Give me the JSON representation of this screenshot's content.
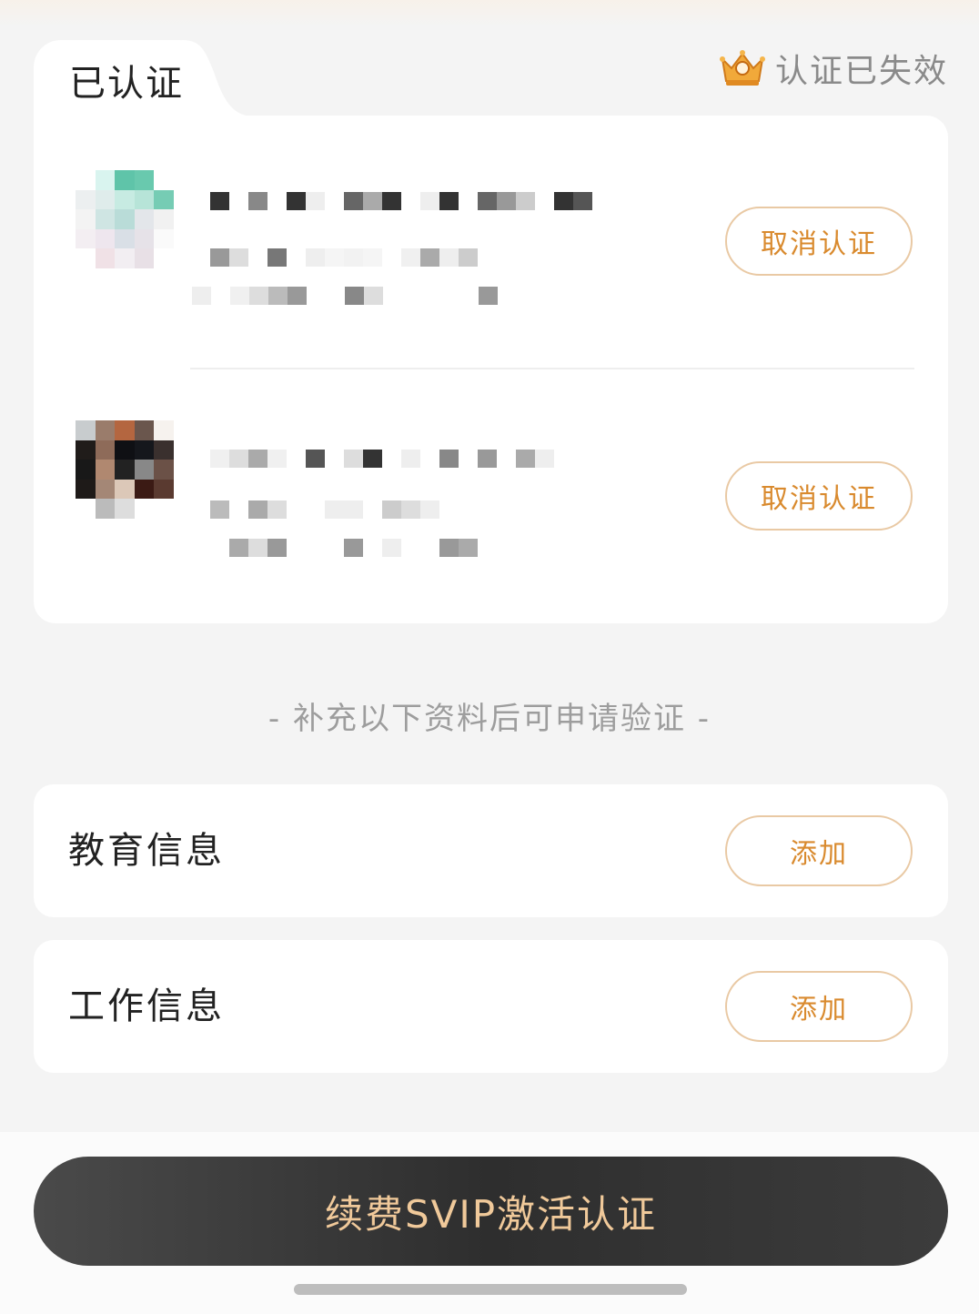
{
  "header": {
    "tab_label": "已认证",
    "status_text": "认证已失效",
    "status_icon": "crown-icon"
  },
  "verified_accounts": [
    {
      "cancel_label": "取消认证"
    },
    {
      "cancel_label": "取消认证"
    }
  ],
  "hint_text": "- 补充以下资料后可申请验证 -",
  "profile_sections": [
    {
      "label": "教育信息",
      "action_label": "添加"
    },
    {
      "label": "工作信息",
      "action_label": "添加"
    }
  ],
  "cta": {
    "label": "续费SVIP激活认证"
  },
  "colors": {
    "accent": "#d98a2e",
    "button_border": "#e9c9a4",
    "cta_text": "#f0c99a",
    "cta_bg": "#3a3a3a",
    "page_bg": "#f4f4f4"
  }
}
